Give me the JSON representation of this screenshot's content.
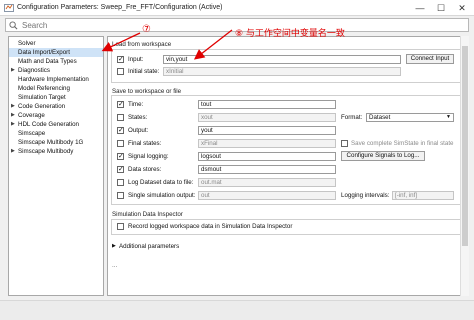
{
  "window": {
    "title": "Configuration Parameters: Sweep_Fre_FFT/Configuration (Active)",
    "minimize": "—",
    "maximize": "☐",
    "close": "✕"
  },
  "search": {
    "placeholder": "Search"
  },
  "tree": {
    "items": [
      {
        "label": "Solver",
        "expandable": false
      },
      {
        "label": "Data Import/Export",
        "expandable": false,
        "selected": true
      },
      {
        "label": "Math and Data Types",
        "expandable": false
      },
      {
        "label": "Diagnostics",
        "expandable": true
      },
      {
        "label": "Hardware Implementation",
        "expandable": false
      },
      {
        "label": "Model Referencing",
        "expandable": false
      },
      {
        "label": "Simulation Target",
        "expandable": false
      },
      {
        "label": "Code Generation",
        "expandable": true
      },
      {
        "label": "Coverage",
        "expandable": true
      },
      {
        "label": "HDL Code Generation",
        "expandable": true
      },
      {
        "label": "Simscape",
        "expandable": false
      },
      {
        "label": "Simscape Multibody 1G",
        "expandable": false
      },
      {
        "label": "Simscape Multibody",
        "expandable": true
      }
    ]
  },
  "load": {
    "heading": "Load from workspace",
    "input_label": "Input:",
    "input_value": "vin,yout",
    "input_checked": true,
    "connect_button": "Connect Input",
    "initial_label": "Initial state:",
    "initial_value": "xInitial",
    "initial_checked": false
  },
  "save": {
    "heading": "Save to workspace or file",
    "time_label": "Time:",
    "time_value": "tout",
    "time_checked": true,
    "states_label": "States:",
    "states_value": "xout",
    "states_checked": false,
    "format_label": "Format:",
    "format_value": "Dataset",
    "output_label": "Output:",
    "output_value": "yout",
    "output_checked": true,
    "final_label": "Final states:",
    "final_value": "xFinal",
    "final_checked": false,
    "simstate_label": "Save complete SimState in final state",
    "simstate_checked": false,
    "signal_label": "Signal logging:",
    "signal_value": "logsout",
    "signal_checked": true,
    "configure_button": "Configure Signals to Log...",
    "datastores_label": "Data stores:",
    "datastores_value": "dsmout",
    "datastores_checked": true,
    "logdataset_label": "Log Dataset data to file:",
    "logdataset_value": "out.mat",
    "logdataset_checked": false,
    "single_label": "Single simulation output:",
    "single_value": "out",
    "single_checked": false,
    "logging_intervals_label": "Logging intervals:",
    "logging_intervals_value": "[-inf, inf]"
  },
  "inspector": {
    "heading": "Simulation Data Inspector",
    "record_label": "Record logged workspace data in Simulation Data Inspector",
    "record_checked": false
  },
  "additional": {
    "label": "Additional parameters",
    "ellipsis": "..."
  },
  "annotations": {
    "note7": "⑦",
    "note8": "⑧ 与工作空间中变量名一致",
    "color": "#e00000"
  }
}
